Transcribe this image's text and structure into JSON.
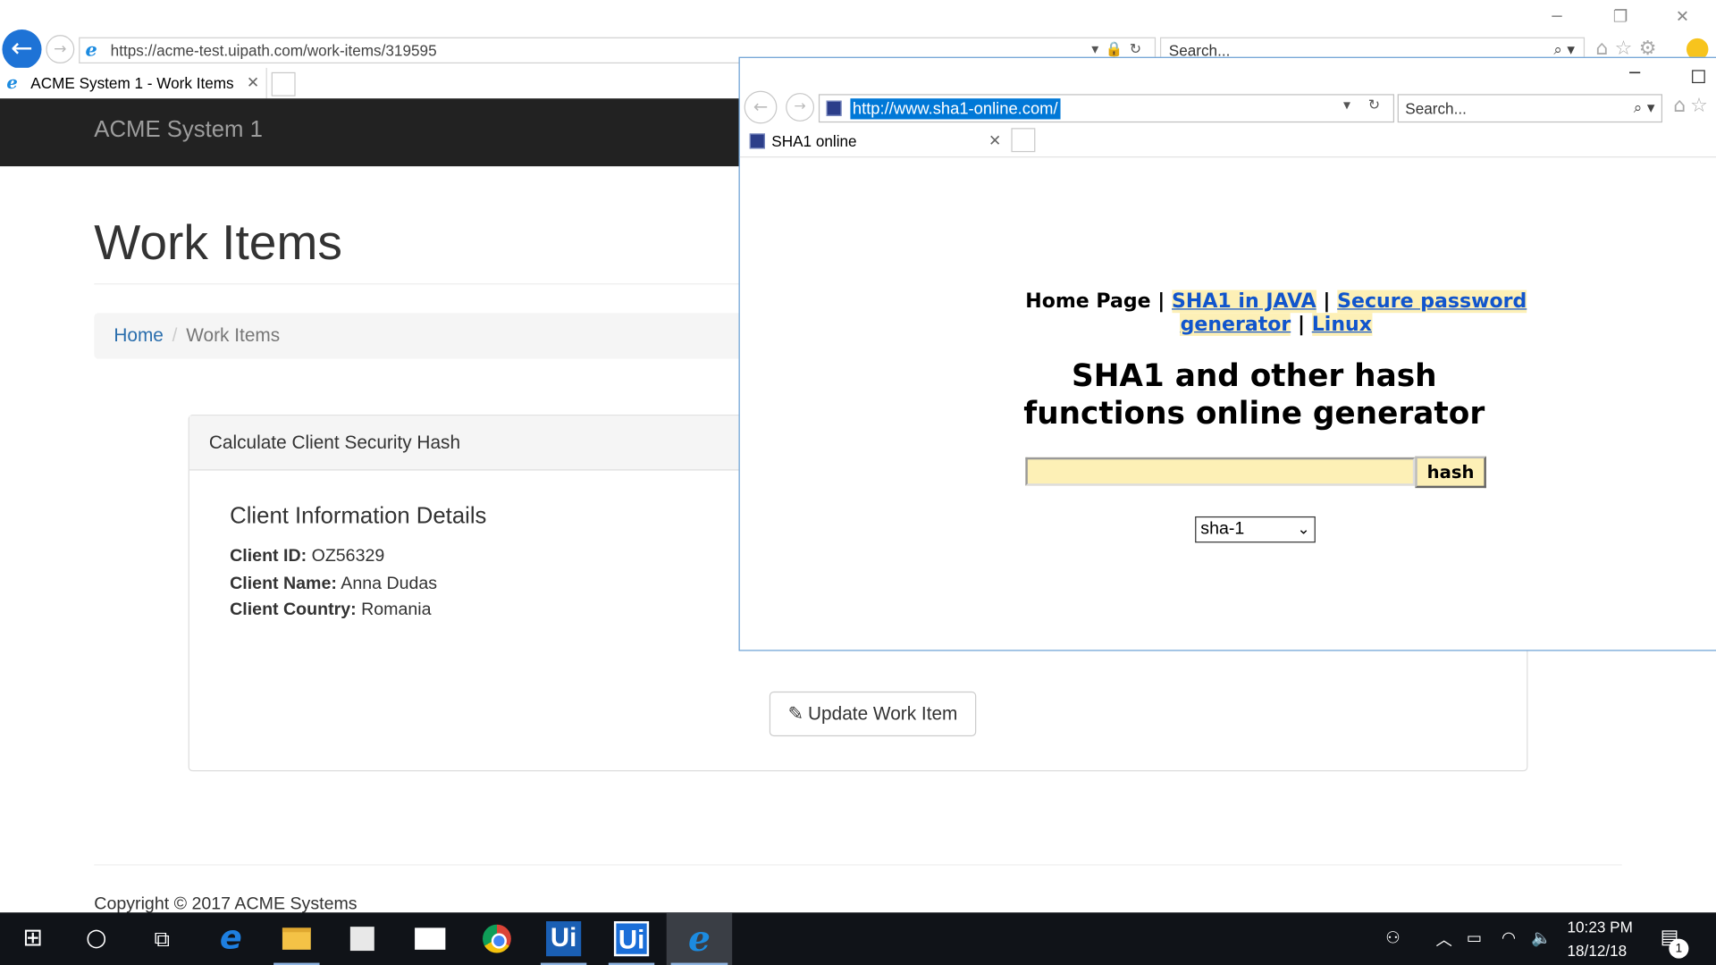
{
  "browser": {
    "url": "https://acme-test.uipath.com/work-items/319595",
    "search_placeholder": "Search...",
    "tab_title": "ACME System 1 - Work Items"
  },
  "acme": {
    "brand": "ACME System 1",
    "page_title": "Work Items",
    "breadcrumb": {
      "home": "Home",
      "current": "Work Items"
    },
    "panel_title": "Calculate Client Security Hash",
    "client_heading": "Client Information Details",
    "client_id_label": "Client ID:",
    "client_id": "OZ56329",
    "client_name_label": "Client Name:",
    "client_name": "Anna Dudas",
    "client_country_label": "Client Country:",
    "client_country": "Romania",
    "update_button": "Update Work Item",
    "copyright": "Copyright © 2017 ACME Systems"
  },
  "popup": {
    "url": "http://www.sha1-online.com/",
    "search_placeholder": "Search...",
    "tab_title": "SHA1 online",
    "nav": {
      "home": "Home Page",
      "java": "SHA1 in JAVA",
      "secure": "Secure password generator",
      "linux": "Linux",
      "sep": "|"
    },
    "title_line1": "SHA1 and other hash",
    "title_line2": "functions online generator",
    "input_value": "",
    "hash_button": "hash",
    "algo_selected": "sha-1"
  },
  "taskbar": {
    "time": "10:23 PM",
    "date": "18/12/18",
    "notification_count": "1",
    "apps": [
      "start",
      "cortana",
      "task-view",
      "edge",
      "file-explorer",
      "store",
      "mail",
      "chrome",
      "uipath-studio",
      "uipath-robot",
      "internet-explorer"
    ]
  },
  "colors": {
    "acme_nav": "#222222",
    "link": "#2a6ead",
    "sha_highlight": "#fdf0b6",
    "sha_link": "#1155cc",
    "ie_blue": "#1e73d6",
    "taskbar": "#101318"
  }
}
